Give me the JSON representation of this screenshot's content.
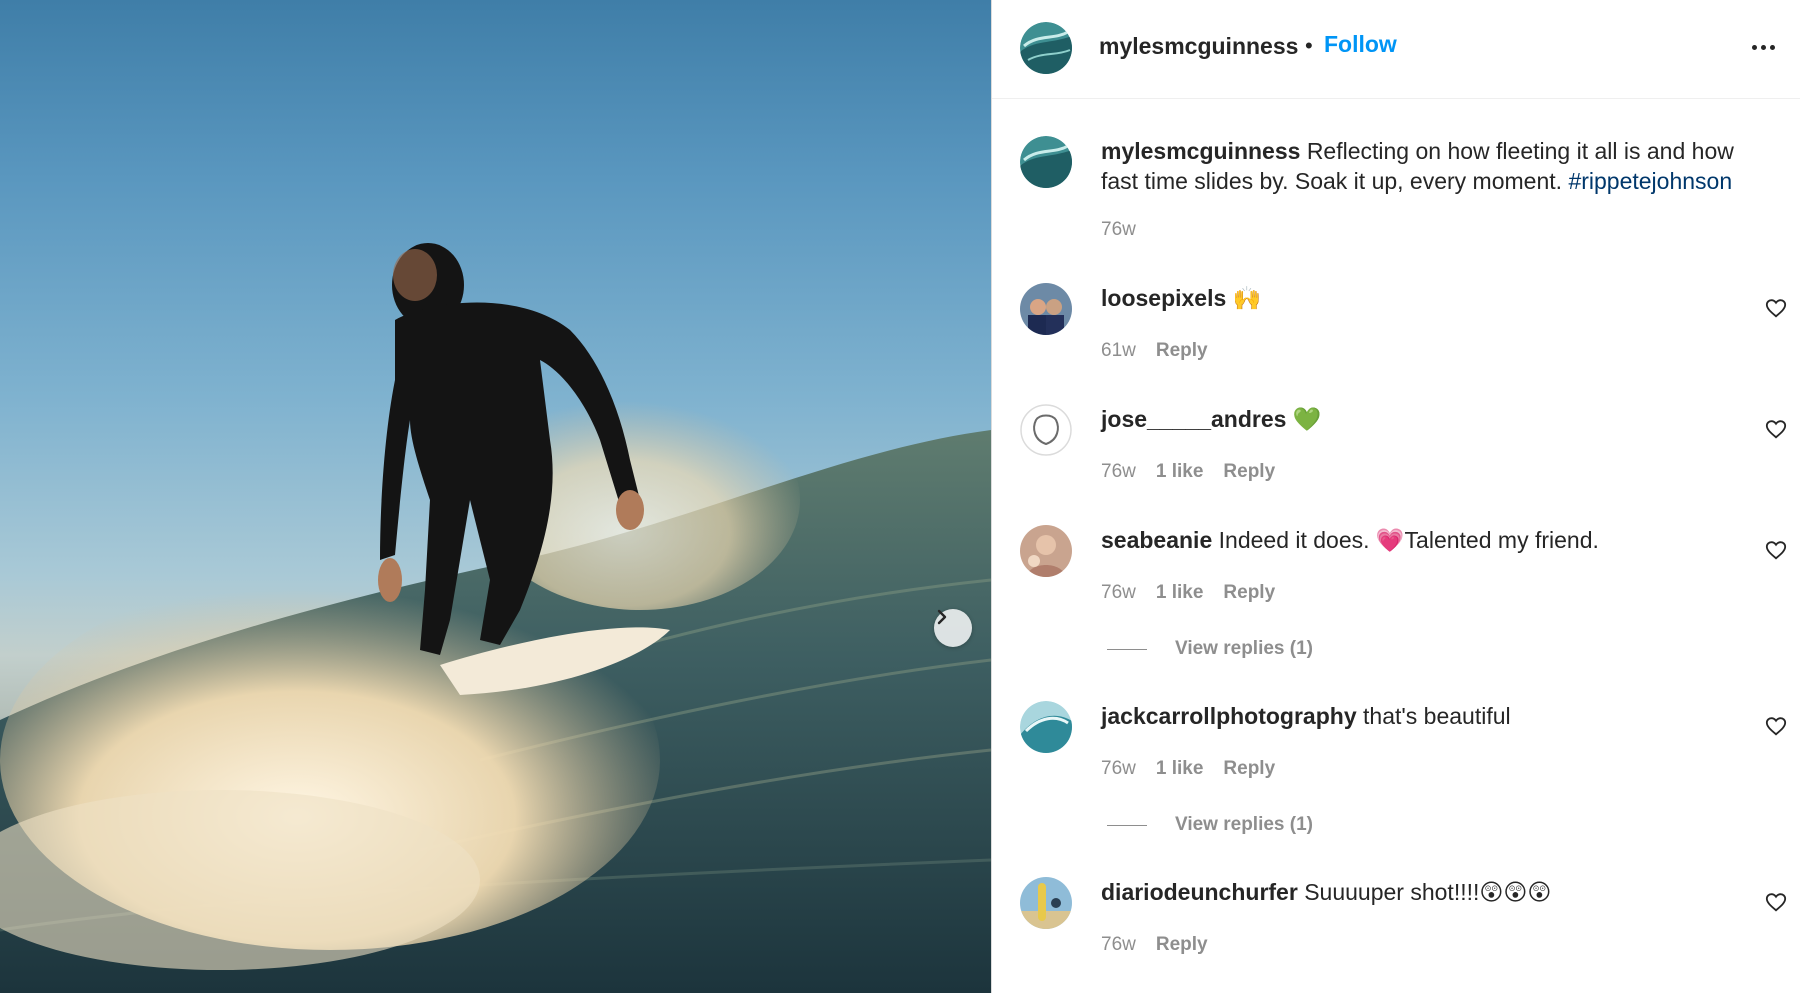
{
  "post": {
    "username": "mylesmcguinness",
    "follow_label": "Follow",
    "separator": "•"
  },
  "caption": {
    "username": "mylesmcguinness",
    "text": "Reflecting on how fleeting it all is and how fast time slides by. Soak it up, every moment.",
    "hashtag": "#rippetejohnson",
    "age": "76w"
  },
  "comments": [
    {
      "username": "loosepixels",
      "text": "🙌",
      "age": "61w",
      "likes": "",
      "reply_label": "Reply"
    },
    {
      "username": "jose_____andres",
      "text": "💚",
      "age": "76w",
      "likes": "1 like",
      "reply_label": "Reply"
    },
    {
      "username": "seabeanie",
      "text": "Indeed it does. 💗Talented my friend.",
      "age": "76w",
      "likes": "1 like",
      "reply_label": "Reply",
      "view_replies": "View replies (1)"
    },
    {
      "username": "jackcarrollphotography",
      "text": "that's beautiful",
      "age": "76w",
      "likes": "1 like",
      "reply_label": "Reply",
      "view_replies": "View replies (1)"
    },
    {
      "username": "diariodeunchurfer",
      "text": "Suuuuper shot!!!!😲😲😲",
      "age": "76w",
      "likes": "",
      "reply_label": "Reply"
    }
  ],
  "colors": {
    "link": "#0095f6",
    "hashtag": "#00376b",
    "muted": "#8e8e8e"
  },
  "icons": {
    "more": "more-horizontal-icon",
    "like": "heart-outline-icon",
    "next": "chevron-right-icon"
  }
}
